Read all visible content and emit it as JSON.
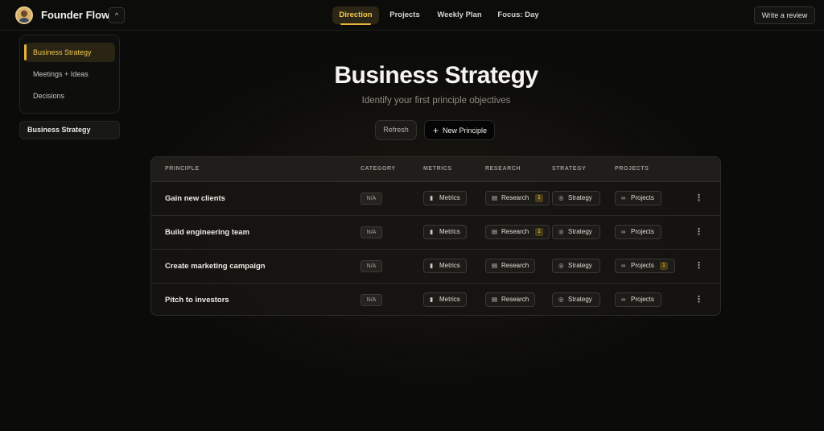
{
  "app": {
    "brand": "Founder Flow",
    "collapse_icon": "chevron-up-icon",
    "collapse_glyph": "^"
  },
  "nav": {
    "items": [
      {
        "label": "Direction",
        "active": true
      },
      {
        "label": "Projects",
        "active": false
      },
      {
        "label": "Weekly Plan",
        "active": false
      },
      {
        "label": "Focus: Day",
        "active": false
      }
    ],
    "review_label": "Write a review"
  },
  "sidebar": {
    "items": [
      {
        "label": "Business Strategy",
        "active": true
      },
      {
        "label": "Meetings + Ideas",
        "active": false
      },
      {
        "label": "Decisions",
        "active": false
      }
    ],
    "selected_card": "Business Strategy"
  },
  "hero": {
    "title": "Business Strategy",
    "subtitle": "Identify your first principle objectives",
    "refresh_label": "Refresh",
    "new_label": "New Principle",
    "new_icon": "plus-icon"
  },
  "table": {
    "headers": [
      "PRINCIPLE",
      "CATEGORY",
      "METRICS",
      "RESEARCH",
      "STRATEGY",
      "PROJECTS"
    ],
    "chip_labels": {
      "metrics": "Metrics",
      "research": "Research",
      "strategy": "Strategy",
      "projects": "Projects"
    },
    "rows": [
      {
        "principle": "Gain new clients",
        "category": "N/A",
        "research_count": "1",
        "projects_count": ""
      },
      {
        "principle": "Build engineering team",
        "category": "N/A",
        "research_count": "1",
        "projects_count": ""
      },
      {
        "principle": "Create marketing campaign",
        "category": "N/A",
        "research_count": "",
        "projects_count": "1"
      },
      {
        "principle": "Pitch to investors",
        "category": "N/A",
        "research_count": "",
        "projects_count": ""
      }
    ]
  },
  "colors": {
    "accent": "#e4b53a",
    "accent_text": "#f2c94c",
    "background": "#0b0b0a"
  }
}
